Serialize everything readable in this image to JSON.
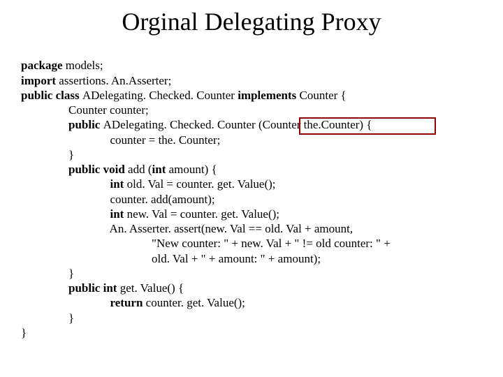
{
  "title": "Orginal Delegating Proxy",
  "code": {
    "l1a": "package",
    "l1b": " models;",
    "l2a": "import",
    "l2b": " assertions. An.Asserter;",
    "l3a": "public class ",
    "l3b": "ADelegating. Checked. Counter ",
    "l3c": "implements",
    "l3d": " Counter {",
    "l4": "                Counter counter;",
    "l5a": "                public ",
    "l5b": "ADelegating. Checked. Counter ",
    "l5c": "(Counter the.Counter) {",
    "l6": "                              counter = the. Counter;",
    "l7": "                }",
    "l8a": "                public void ",
    "l8b": "add (",
    "l8c": "int",
    "l8d": " amount) {",
    "l9a": "                              int",
    "l9b": " old. Val = counter. get. Value();",
    "l10": "                              counter. add(amount);",
    "l11a": "                              int",
    "l11b": " new. Val = counter. get. Value();",
    "l12": "                              An. Asserter. assert(new. Val == old. Val + amount,",
    "l13": "                                            \"New counter: \" + new. Val + \" != old counter: \" +",
    "l14": "                                            old. Val + \" + amount: \" + amount);",
    "l15": "                }",
    "l16a": "                public int ",
    "l16b": "get. Value() {",
    "l17a": "                              return",
    "l17b": " counter. get. Value();",
    "l18": "                }",
    "l19": "}"
  }
}
